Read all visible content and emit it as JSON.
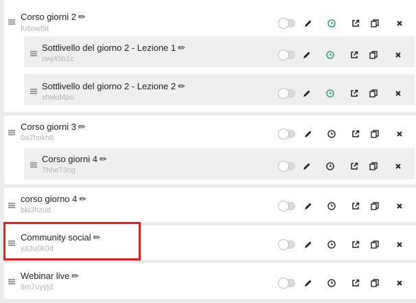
{
  "courses": [
    {
      "title": "Corso giorni 2",
      "code": "fu6nw5lt",
      "status_color": "#3aa17e"
    },
    {
      "title": "Sottlivello del giorno 2 - Lezione 1",
      "code": "nwj45h1c",
      "status_color": "#3aa17e"
    },
    {
      "title": "Sottlivello del giorno 2 - Lezione 2",
      "code": "xhxkd4po",
      "status_color": "#3aa17e"
    },
    {
      "title": "Corso giorni 3",
      "code": "0a7hokh8",
      "status_color": "#333333"
    },
    {
      "title": "Corso giorni 4",
      "code": "7hhe73ng",
      "status_color": "#333333"
    },
    {
      "title": "corso giorno 4",
      "code": "bki3hzud",
      "status_color": "#333333"
    },
    {
      "title": "Community social",
      "code": "ya3u0k0d",
      "status_color": "#333333"
    },
    {
      "title": "Webinar live",
      "code": "8m7uyyjd",
      "status_color": "#333333"
    }
  ],
  "icons": {
    "handle": "drag-handle-icon",
    "edit": "pencil-icon",
    "status": "clock-icon",
    "open": "external-link-icon",
    "duplicate": "copy-icon",
    "delete": "close-icon"
  },
  "highlight_color": "#e02020"
}
